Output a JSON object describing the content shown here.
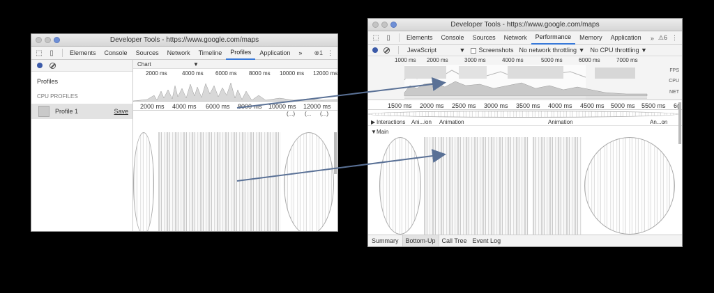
{
  "left_window": {
    "title": "Developer Tools - https://www.google.com/maps",
    "tabs": [
      "Elements",
      "Console",
      "Sources",
      "Network",
      "Timeline",
      "Profiles",
      "Application"
    ],
    "selected_tab": "Profiles",
    "more_tabs": "»",
    "error_count": "1",
    "sidebar": {
      "header": "Profiles",
      "section": "CPU PROFILES",
      "profile_name": "Profile 1",
      "save_label": "Save"
    },
    "view_select": "Chart",
    "overview_ticks": [
      "2000 ms",
      "4000 ms",
      "6000 ms",
      "8000 ms",
      "10000 ms",
      "12000 ms"
    ],
    "main_ticks": [
      "2000 ms",
      "4000 ms",
      "6000 ms",
      "8000 ms",
      "10000 ms",
      "12000 ms"
    ],
    "ellipsis": [
      "(...)",
      "(...",
      "(...)"
    ]
  },
  "right_window": {
    "title": "Developer Tools - https://www.google.com/maps",
    "tabs": [
      "Elements",
      "Console",
      "Sources",
      "Network",
      "Performance",
      "Memory",
      "Application"
    ],
    "selected_tab": "Performance",
    "more_tabs": "»",
    "warning_count": "6",
    "toolbar": {
      "mode": "JavaScript",
      "screenshots_label": "Screenshots",
      "network_throttling": "No network throttling",
      "cpu_throttling": "No CPU throttling"
    },
    "overview_ticks": [
      "1000 ms",
      "2000 ms",
      "3000 ms",
      "4000 ms",
      "5000 ms",
      "6000 ms",
      "7000 ms"
    ],
    "overview_labels": [
      "FPS",
      "CPU",
      "NET"
    ],
    "main_ticks": [
      "1500 ms",
      "2000 ms",
      "2500 ms",
      "3000 ms",
      "3500 ms",
      "4000 ms",
      "4500 ms",
      "5000 ms",
      "5500 ms",
      "6("
    ],
    "interactions": {
      "label": "Interactions",
      "items": [
        "Ani...ion",
        "Animation",
        "Animation",
        "An...on"
      ]
    },
    "main_label": "Main",
    "bottom_tabs": [
      "Summary",
      "Bottom-Up",
      "Call Tree",
      "Event Log"
    ],
    "selected_bottom_tab": "Bottom-Up"
  },
  "colors": {
    "background": "#000000",
    "selected_tab_underline": "#3879d9",
    "arrow": "#5a7196"
  }
}
